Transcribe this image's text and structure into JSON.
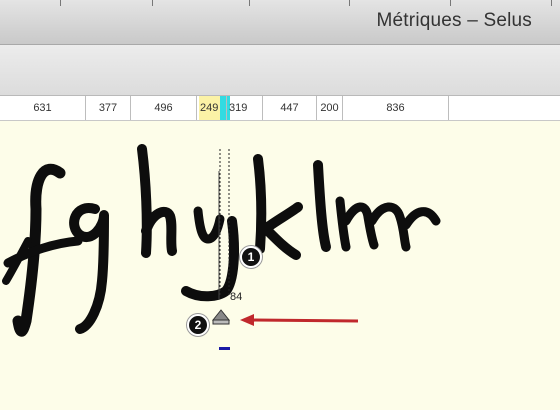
{
  "window": {
    "title": "Métriques – Selus"
  },
  "ruler": {
    "widths": [
      "631",
      "377",
      "496",
      "249",
      "319",
      "447",
      "200",
      "836"
    ]
  },
  "glyph_text": "fghijklm",
  "metric_value": "84",
  "callouts": [
    "1",
    "2"
  ],
  "colors": {
    "arrow": "#c0282c",
    "cyan_highlight": "#32dbe2",
    "yellow_highlight": "#fbf2a6",
    "canvas_bg": "#fdfde9"
  },
  "icons": [
    "sidebearing-handle-icon",
    "arrow-icon"
  ]
}
